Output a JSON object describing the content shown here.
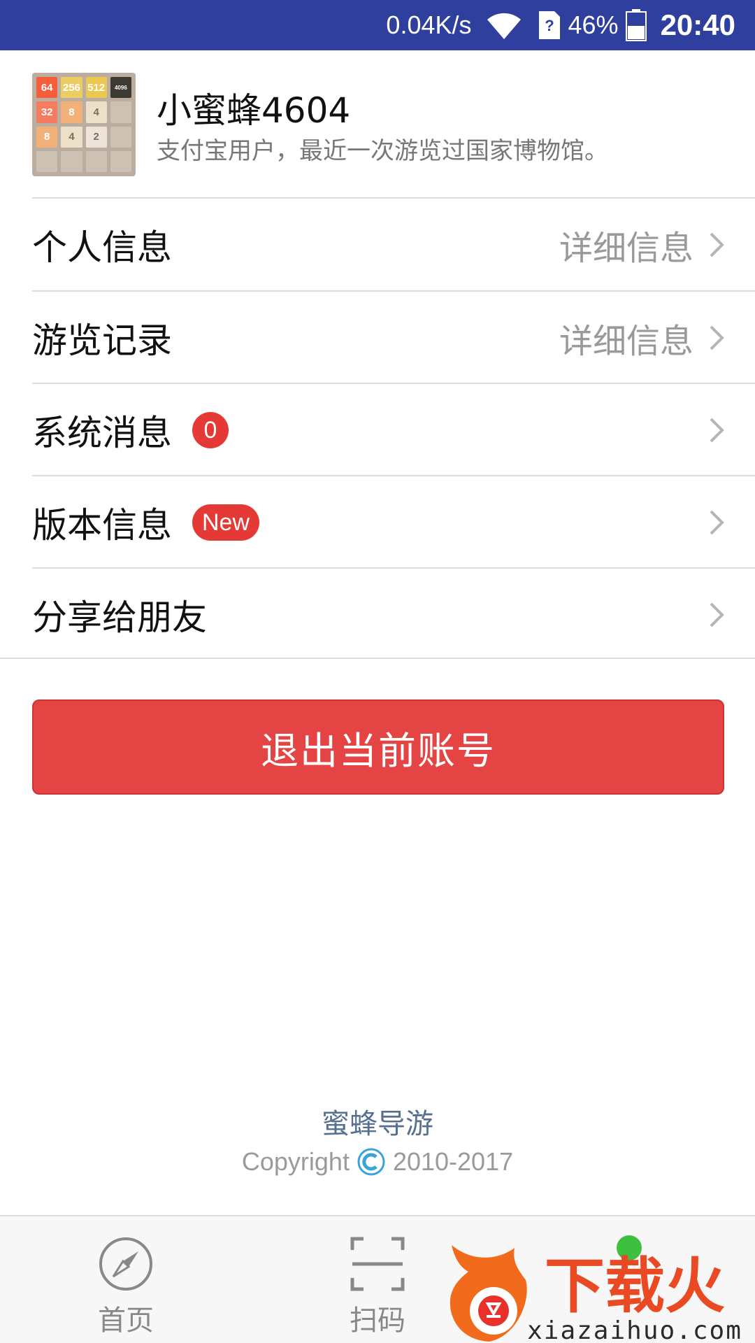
{
  "status_bar": {
    "network_speed": "0.04K/s",
    "battery_percent": "46%",
    "time": "20:40"
  },
  "profile": {
    "username": "小蜜蜂4604",
    "description": "支付宝用户，最近一次游览过国家博物馆。",
    "avatar_tiles": [
      "64",
      "256",
      "512",
      "4096",
      "32",
      "8",
      "4",
      "",
      "8",
      "4",
      "2",
      "",
      "",
      "",
      "",
      ""
    ]
  },
  "menu": {
    "personal_info": {
      "label": "个人信息",
      "detail": "详细信息"
    },
    "visit_history": {
      "label": "游览记录",
      "detail": "详细信息"
    },
    "system_messages": {
      "label": "系统消息",
      "badge": "0"
    },
    "version_info": {
      "label": "版本信息",
      "badge": "New"
    },
    "share": {
      "label": "分享给朋友"
    }
  },
  "logout_button": "退出当前账号",
  "footer": {
    "brand": "蜜蜂导游",
    "copyright_prefix": "Copyright",
    "copyright_years": "2010-2017"
  },
  "bottom_nav": {
    "home": {
      "label": "首页",
      "icon": "compass-icon"
    },
    "scan": {
      "label": "扫码",
      "icon": "scan-icon"
    }
  },
  "watermark": {
    "text": "下载火",
    "url": "xiazaihuo.com"
  },
  "colors": {
    "status_bar": "#2f3f9e",
    "accent_red": "#e44444",
    "badge_red": "#e53935",
    "brand_text": "#56708f"
  }
}
